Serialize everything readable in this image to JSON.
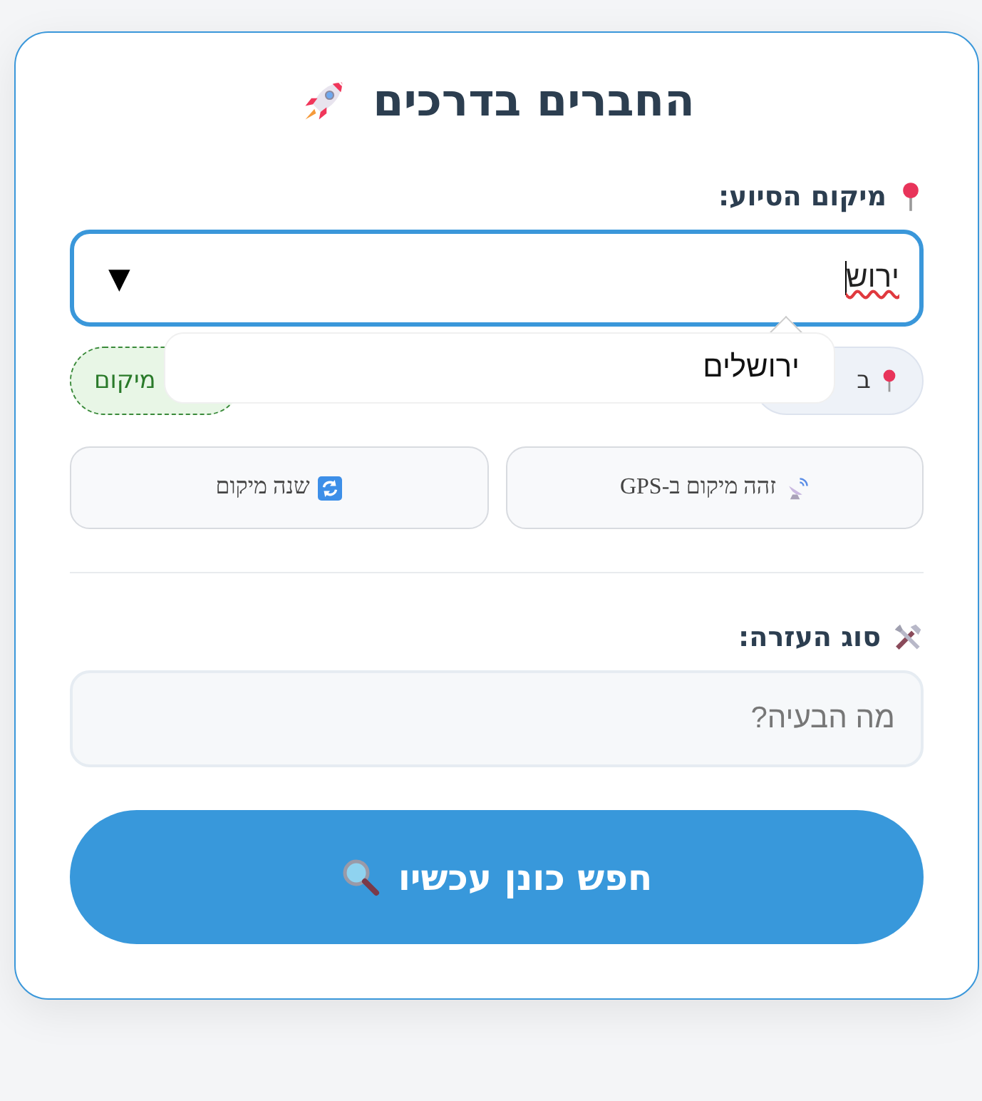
{
  "title": "החברים בדרכים",
  "location": {
    "label": "מיקום הסיוע:",
    "value": "ירוש",
    "suggestions": [
      "ירושלים"
    ],
    "caret": "▼"
  },
  "chips": [
    {
      "kind": "current",
      "text": "ב"
    },
    {
      "kind": "dashed",
      "text": "מיקום"
    }
  ],
  "actions": [
    {
      "kind": "gps",
      "label": "זהה מיקום ב-GPS"
    },
    {
      "kind": "change",
      "label": "שנה מיקום"
    }
  ],
  "help": {
    "label": "סוג העזרה:",
    "placeholder": "מה הבעיה?"
  },
  "submit": {
    "label": "חפש כונן עכשיו"
  }
}
